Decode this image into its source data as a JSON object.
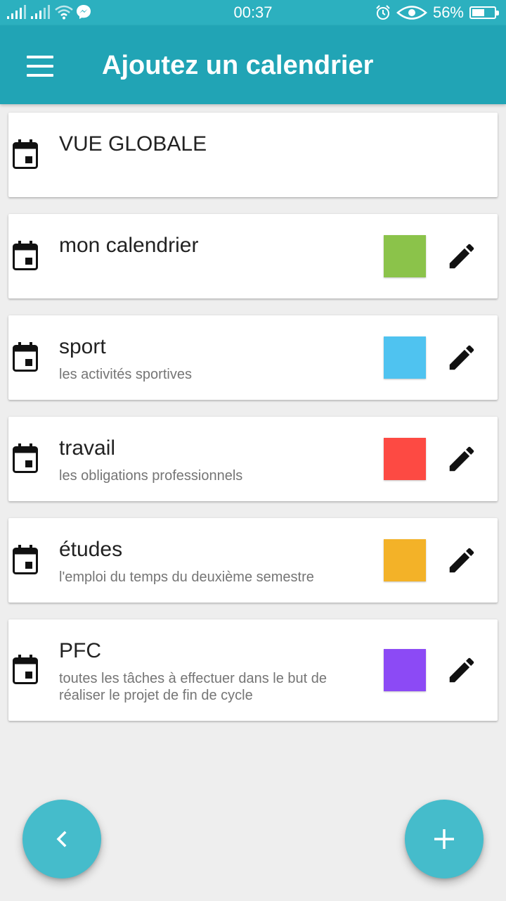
{
  "status_bar": {
    "time": "00:37",
    "battery_percent": "56%",
    "battery_level": 0.56,
    "icons": [
      "signal-icon",
      "signal-icon",
      "wifi-icon",
      "messenger-icon",
      "alarm-icon",
      "eye-icon",
      "battery-icon"
    ]
  },
  "app_bar": {
    "title": "Ajoutez un calendrier",
    "menu_icon": "menu-icon"
  },
  "calendars": [
    {
      "title": "VUE GLOBALE",
      "subtitle": "",
      "color": null,
      "editable": false
    },
    {
      "title": "mon calendrier",
      "subtitle": "",
      "color": "#8bc34a",
      "editable": true
    },
    {
      "title": "sport",
      "subtitle": "les activités sportives",
      "color": "#4fc3f0",
      "editable": true
    },
    {
      "title": "travail",
      "subtitle": "les obligations professionnels",
      "color": "#fd4a43",
      "editable": true
    },
    {
      "title": "études",
      "subtitle": "l'emploi du temps du deuxième semestre",
      "color": "#f3b228",
      "editable": true
    },
    {
      "title": "PFC",
      "subtitle": "toutes les tâches à effectuer dans le but de réaliser le projet de fin de cycle",
      "color": "#8c4af5",
      "editable": true
    }
  ],
  "fab": {
    "back_icon": "chevron-left-icon",
    "add_icon": "plus-icon",
    "color": "#45bccb"
  },
  "colors": {
    "status_bar": "#2cb0bf",
    "app_bar": "#21a4b5",
    "background": "#eeeeee"
  }
}
